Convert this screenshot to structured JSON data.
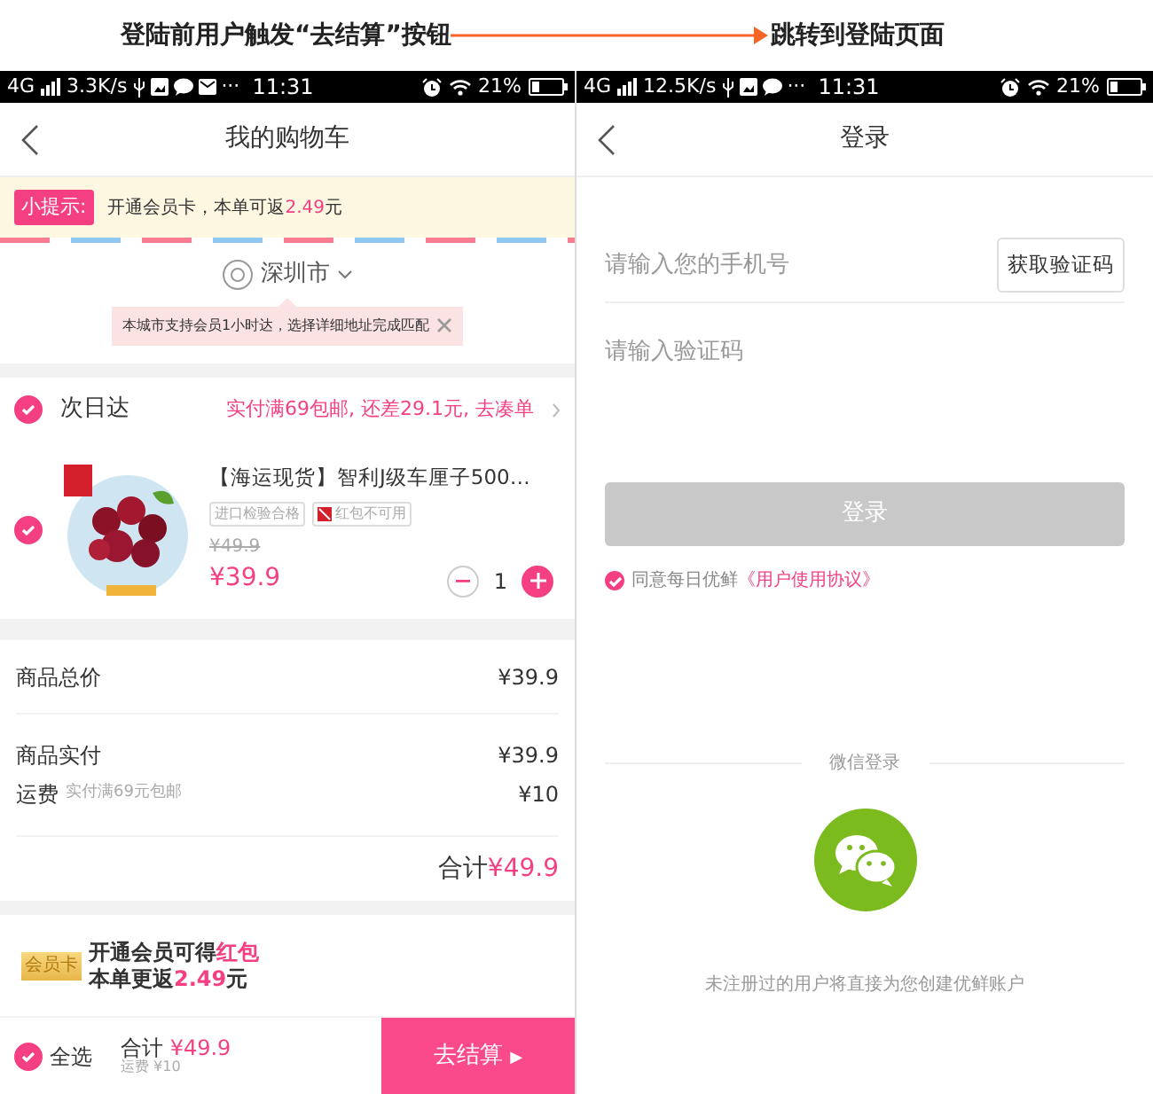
{
  "caption": {
    "left": "登陆前用户触发“去结算”按钮",
    "right": "跳转到登陆页面"
  },
  "cart_screen": {
    "status_bar": {
      "network": "4G",
      "speed": "3.3K/s",
      "more": "···",
      "time": "11:31",
      "battery": "21%"
    },
    "title": "我的购物车",
    "tip": {
      "label": "小提示:",
      "text": "开通会员卡，本单可返",
      "amount": "2.49",
      "unit": "元"
    },
    "city": "深圳市",
    "tooltip": "本城市支持会员1小时达，选择详细地址完成匹配",
    "group": {
      "name": "次日达",
      "checked": true,
      "promo": "实付满69包邮, 还差29.1元, 去凑单"
    },
    "items": [
      {
        "checked": true,
        "title": "【海运现货】智利J级车厘子500…",
        "tags": [
          {
            "kind": "plain",
            "text": "进口检验合格"
          },
          {
            "kind": "coupon",
            "text": "红包不可用"
          }
        ],
        "original_price": "¥49.9",
        "price": "¥39.9",
        "quantity": "1"
      }
    ],
    "summary": [
      {
        "label": "商品总价",
        "value": "¥39.9"
      },
      {
        "label": "商品实付",
        "value": "¥39.9"
      },
      {
        "label": "运费",
        "note": "实付满69元包邮",
        "value": "¥10"
      }
    ],
    "total": {
      "label": "合计",
      "value": "¥49.9"
    },
    "member": {
      "badge": "会员卡",
      "line1": "开通会员可得",
      "line1_highlight": "红包",
      "line2": "本单更返",
      "amount": "2.49",
      "unit": "元"
    },
    "footer": {
      "select_all": "全选",
      "checked": true,
      "total_label": "合计",
      "total": "¥49.9",
      "shipping": "运费 ¥10",
      "checkout": "去结算",
      "checkout_arrow": "▶"
    }
  },
  "login_screen": {
    "status_bar": {
      "network": "4G",
      "speed": "12.5K/s",
      "more": "···",
      "time": "11:31",
      "battery": "21%"
    },
    "title": "登录",
    "phone": {
      "placeholder": "请输入您的手机号"
    },
    "code_button": "获取验证码",
    "code": {
      "placeholder": "请输入验证码"
    },
    "login_button": {
      "label": "登录",
      "disabled": true
    },
    "agree": {
      "checked": true,
      "text": "同意每日优鲜",
      "link": "《用户使用协议》"
    },
    "wechat_label": "微信登录",
    "note": "未注册过的用户将直接为您创建优鲜账户"
  }
}
